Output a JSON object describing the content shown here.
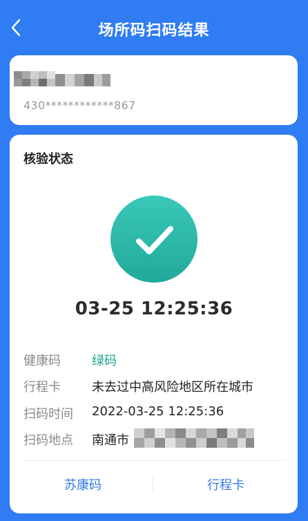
{
  "header": {
    "title": "场所码扫码结果",
    "back_icon": "chevron-left-icon"
  },
  "identity": {
    "id_number": "430************867"
  },
  "verification": {
    "section_title": "核验状态",
    "status_icon": "check-circle-icon",
    "status_color": "#2ab8a8",
    "datetime": "03-25  12:25:36"
  },
  "details": {
    "rows": [
      {
        "label": "健康码",
        "value": "绿码"
      },
      {
        "label": "行程卡",
        "value": "未去过中高风险地区所在城市"
      },
      {
        "label": "扫码时间",
        "value": "2022-03-25  12:25:36"
      },
      {
        "label": "扫码地点",
        "value": "南通市"
      }
    ]
  },
  "footer": {
    "left_label": "苏康码",
    "right_label": "行程卡"
  },
  "colors": {
    "background": "#2f7cf3",
    "accent": "#3178e8",
    "green_code": "#1aa38f"
  }
}
